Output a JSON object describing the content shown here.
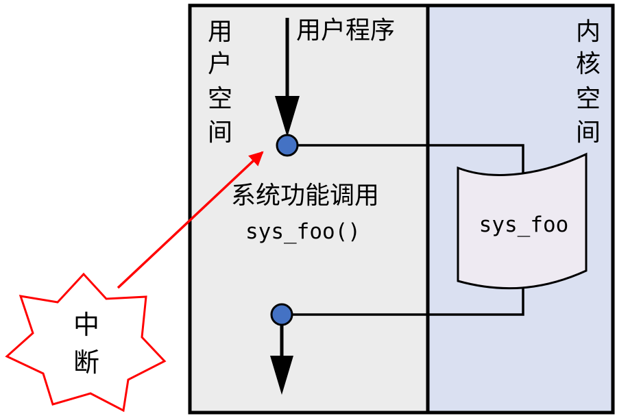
{
  "diagram": {
    "user_space_label": [
      "用",
      "户",
      "空",
      "间"
    ],
    "kernel_space_label": [
      "内",
      "核",
      "空",
      "间"
    ],
    "user_program_label": "用户程序",
    "syscall_label": "系统功能调用",
    "syscall_func": "sys_foo()",
    "kernel_func": "sys_foo",
    "interrupt_label": [
      "中",
      "断"
    ]
  },
  "colors": {
    "user_space_bg": "#ececec",
    "kernel_space_bg": "#dae0f1",
    "kernel_doc_fill": "#eeeaf2",
    "border": "#000000",
    "node_fill": "#4472c4",
    "interrupt": "#ff0000"
  }
}
